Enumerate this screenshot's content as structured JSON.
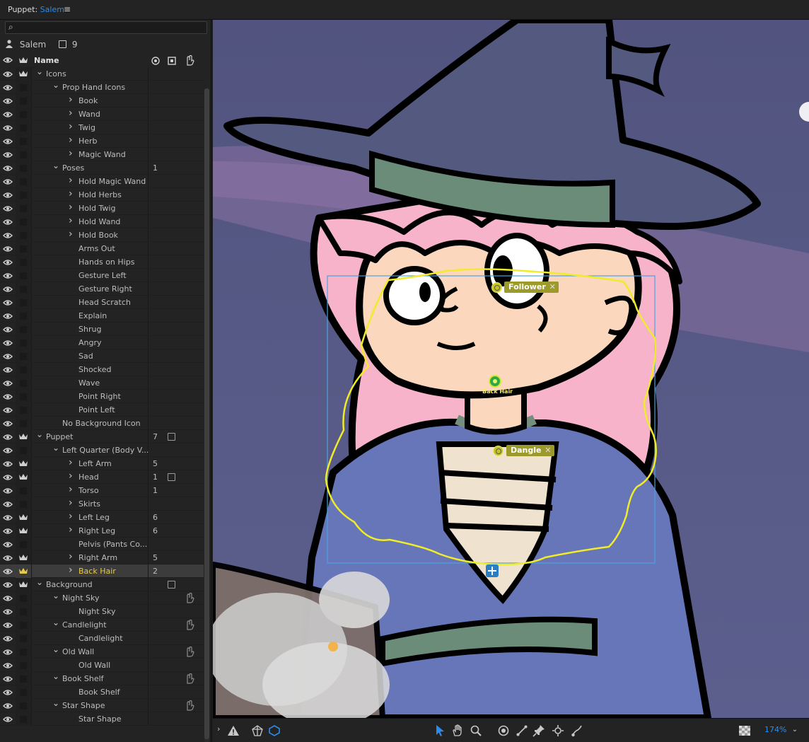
{
  "panel": {
    "title_prefix": "Puppet:",
    "title_name": "Salem",
    "menu_icon": "hamburger-icon"
  },
  "search": {
    "value": "",
    "placeholder": ""
  },
  "puppet": {
    "name": "Salem",
    "count": "9"
  },
  "columns": {
    "name": "Name"
  },
  "rows": [
    {
      "label": "Icons",
      "depth": 0,
      "chevron": "down",
      "crown": true,
      "num": "",
      "bag": false,
      "hand": false
    },
    {
      "label": "Prop Hand Icons",
      "depth": 1,
      "chevron": "down",
      "crown": false,
      "num": "",
      "bag": false,
      "hand": false
    },
    {
      "label": "Book",
      "depth": 2,
      "chevron": "right",
      "crown": false,
      "num": "",
      "bag": false,
      "hand": false
    },
    {
      "label": "Wand",
      "depth": 2,
      "chevron": "right",
      "crown": false,
      "num": "",
      "bag": false,
      "hand": false
    },
    {
      "label": "Twig",
      "depth": 2,
      "chevron": "right",
      "crown": false,
      "num": "",
      "bag": false,
      "hand": false
    },
    {
      "label": "Herb",
      "depth": 2,
      "chevron": "right",
      "crown": false,
      "num": "",
      "bag": false,
      "hand": false
    },
    {
      "label": "Magic Wand",
      "depth": 2,
      "chevron": "right",
      "crown": false,
      "num": "",
      "bag": false,
      "hand": false
    },
    {
      "label": "Poses",
      "depth": 1,
      "chevron": "down",
      "crown": false,
      "num": "1",
      "bag": false,
      "hand": false
    },
    {
      "label": "Hold Magic Wand",
      "depth": 2,
      "chevron": "right",
      "crown": false,
      "num": "",
      "bag": false,
      "hand": false
    },
    {
      "label": "Hold Herbs",
      "depth": 2,
      "chevron": "right",
      "crown": false,
      "num": "",
      "bag": false,
      "hand": false
    },
    {
      "label": "Hold Twig",
      "depth": 2,
      "chevron": "right",
      "crown": false,
      "num": "",
      "bag": false,
      "hand": false
    },
    {
      "label": "Hold Wand",
      "depth": 2,
      "chevron": "right",
      "crown": false,
      "num": "",
      "bag": false,
      "hand": false
    },
    {
      "label": "Hold Book",
      "depth": 2,
      "chevron": "right",
      "crown": false,
      "num": "",
      "bag": false,
      "hand": false
    },
    {
      "label": "Arms Out",
      "depth": 2,
      "chevron": "",
      "crown": false,
      "num": "",
      "bag": false,
      "hand": false
    },
    {
      "label": "Hands on Hips",
      "depth": 2,
      "chevron": "",
      "crown": false,
      "num": "",
      "bag": false,
      "hand": false
    },
    {
      "label": "Gesture Left",
      "depth": 2,
      "chevron": "",
      "crown": false,
      "num": "",
      "bag": false,
      "hand": false
    },
    {
      "label": "Gesture Right",
      "depth": 2,
      "chevron": "",
      "crown": false,
      "num": "",
      "bag": false,
      "hand": false
    },
    {
      "label": "Head Scratch",
      "depth": 2,
      "chevron": "",
      "crown": false,
      "num": "",
      "bag": false,
      "hand": false
    },
    {
      "label": "Explain",
      "depth": 2,
      "chevron": "",
      "crown": false,
      "num": "",
      "bag": false,
      "hand": false
    },
    {
      "label": "Shrug",
      "depth": 2,
      "chevron": "",
      "crown": false,
      "num": "",
      "bag": false,
      "hand": false
    },
    {
      "label": "Angry",
      "depth": 2,
      "chevron": "",
      "crown": false,
      "num": "",
      "bag": false,
      "hand": false
    },
    {
      "label": "Sad",
      "depth": 2,
      "chevron": "",
      "crown": false,
      "num": "",
      "bag": false,
      "hand": false
    },
    {
      "label": "Shocked",
      "depth": 2,
      "chevron": "",
      "crown": false,
      "num": "",
      "bag": false,
      "hand": false
    },
    {
      "label": "Wave",
      "depth": 2,
      "chevron": "",
      "crown": false,
      "num": "",
      "bag": false,
      "hand": false
    },
    {
      "label": "Point Right",
      "depth": 2,
      "chevron": "",
      "crown": false,
      "num": "",
      "bag": false,
      "hand": false
    },
    {
      "label": "Point Left",
      "depth": 2,
      "chevron": "",
      "crown": false,
      "num": "",
      "bag": false,
      "hand": false
    },
    {
      "label": "No Background Icon",
      "depth": 1,
      "chevron": "",
      "crown": false,
      "num": "",
      "bag": false,
      "hand": false
    },
    {
      "label": "Puppet",
      "depth": 0,
      "chevron": "down",
      "crown": true,
      "num": "7",
      "bag": true,
      "hand": false
    },
    {
      "label": "Left Quarter (Body V...",
      "depth": 1,
      "chevron": "down",
      "crown": false,
      "num": "",
      "bag": false,
      "hand": false
    },
    {
      "label": "Left Arm",
      "depth": 2,
      "chevron": "right",
      "crown": true,
      "num": "5",
      "bag": false,
      "hand": false
    },
    {
      "label": "Head",
      "depth": 2,
      "chevron": "right",
      "crown": true,
      "num": "1",
      "bag": true,
      "hand": false
    },
    {
      "label": "Torso",
      "depth": 2,
      "chevron": "right",
      "crown": false,
      "num": "1",
      "bag": false,
      "hand": false
    },
    {
      "label": "Skirts",
      "depth": 2,
      "chevron": "right",
      "crown": false,
      "num": "",
      "bag": false,
      "hand": false
    },
    {
      "label": "Left Leg",
      "depth": 2,
      "chevron": "right",
      "crown": true,
      "num": "6",
      "bag": false,
      "hand": false
    },
    {
      "label": "Right Leg",
      "depth": 2,
      "chevron": "right",
      "crown": true,
      "num": "6",
      "bag": false,
      "hand": false
    },
    {
      "label": "Pelvis (Pants Co...",
      "depth": 2,
      "chevron": "",
      "crown": false,
      "num": "",
      "bag": false,
      "hand": false
    },
    {
      "label": "Right Arm",
      "depth": 2,
      "chevron": "right",
      "crown": true,
      "num": "5",
      "bag": false,
      "hand": false
    },
    {
      "label": "Back Hair",
      "depth": 2,
      "chevron": "right",
      "crown": true,
      "num": "2",
      "bag": false,
      "hand": false,
      "selected": true
    },
    {
      "label": "Background",
      "depth": 0,
      "chevron": "down",
      "crown": true,
      "num": "",
      "bag": true,
      "hand": false
    },
    {
      "label": "Night Sky",
      "depth": 1,
      "chevron": "down",
      "crown": false,
      "num": "",
      "bag": false,
      "hand": true
    },
    {
      "label": "Night Sky",
      "depth": 2,
      "chevron": "",
      "crown": false,
      "num": "",
      "bag": false,
      "hand": false
    },
    {
      "label": "Candlelight",
      "depth": 1,
      "chevron": "down",
      "crown": false,
      "num": "",
      "bag": false,
      "hand": true
    },
    {
      "label": "Candlelight",
      "depth": 2,
      "chevron": "",
      "crown": false,
      "num": "",
      "bag": false,
      "hand": false
    },
    {
      "label": "Old Wall",
      "depth": 1,
      "chevron": "down",
      "crown": false,
      "num": "",
      "bag": false,
      "hand": true
    },
    {
      "label": "Old Wall",
      "depth": 2,
      "chevron": "",
      "crown": false,
      "num": "",
      "bag": false,
      "hand": false
    },
    {
      "label": "Book Shelf",
      "depth": 1,
      "chevron": "down",
      "crown": false,
      "num": "",
      "bag": false,
      "hand": true
    },
    {
      "label": "Book Shelf",
      "depth": 2,
      "chevron": "",
      "crown": false,
      "num": "",
      "bag": false,
      "hand": false
    },
    {
      "label": "Star Shape",
      "depth": 1,
      "chevron": "down",
      "crown": false,
      "num": "",
      "bag": false,
      "hand": true
    },
    {
      "label": "Star Shape",
      "depth": 2,
      "chevron": "",
      "crown": false,
      "num": "",
      "bag": false,
      "hand": false
    }
  ],
  "canvas": {
    "tags": {
      "follower": "Follower",
      "dangle": "Dangle",
      "back_hair": "Back Hair"
    }
  },
  "toolbar": {
    "zoom": "174%",
    "tools": [
      "expand-chevron-icon",
      "warning-icon",
      "mesh-icon",
      "outline-icon",
      "select-arrow-icon",
      "hand-pan-icon",
      "zoom-icon",
      "origin-handle-icon",
      "stick-icon",
      "pin-icon",
      "handle-icon",
      "dragger-icon"
    ]
  },
  "colors": {
    "accent": "#2d8ceb",
    "selected_label": "#e7c94a",
    "tag_fill": "#9c9a2a",
    "yellow_outline": "#f0ec2a",
    "bbox": "#4aa3e0"
  }
}
